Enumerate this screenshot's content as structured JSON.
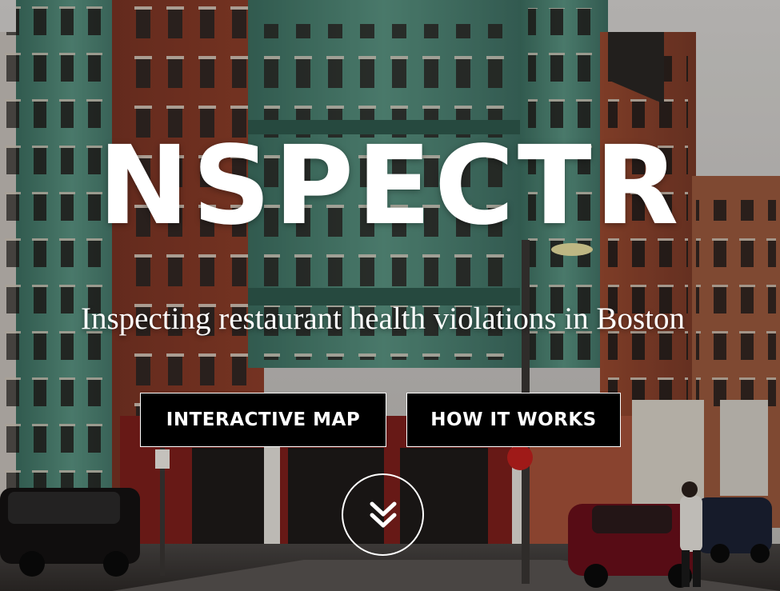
{
  "hero": {
    "title": "NSPECTR",
    "subtitle": "Inspecting restaurant health violations in Boston",
    "buttons": {
      "interactive_map": "INTERACTIVE MAP",
      "how_it_works": "HOW IT WORKS"
    },
    "scroll_icon": "double-chevron-down-icon",
    "background": "photo of brick corner buildings with green bay windows on a Boston street"
  },
  "colors": {
    "text": "#ffffff",
    "button_bg": "#000000",
    "button_border": "#ffffff"
  }
}
